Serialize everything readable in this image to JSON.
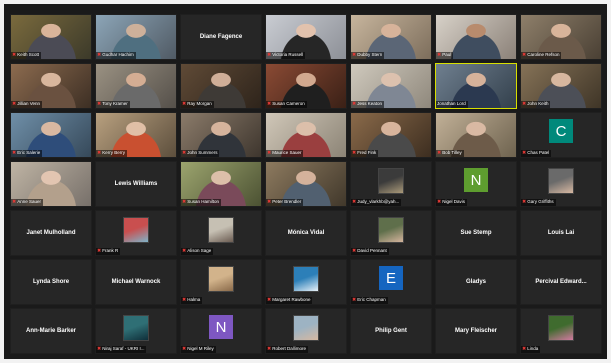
{
  "tiles": [
    {
      "name": "Keith Scott",
      "kind": "video",
      "bg": [
        "#7a6a3d",
        "#3c3a2a"
      ],
      "skin": "#d9b49a",
      "shirt": "#4b4b55",
      "muted": true
    },
    {
      "name": "Gudhar Hachim",
      "kind": "video",
      "bg": [
        "#8ca5b7",
        "#505a64"
      ],
      "skin": "#cdb09a",
      "shirt": "#4f6f80",
      "muted": true
    },
    {
      "name": "Diane Fagence",
      "kind": "name"
    },
    {
      "name": "Victoria Russell",
      "kind": "video",
      "bg": [
        "#c9ccd2",
        "#8d9097"
      ],
      "skin": "#e2c2ad",
      "shirt": "#262626",
      "muted": true
    },
    {
      "name": "Dubby Stern",
      "kind": "video",
      "bg": [
        "#c7b59d",
        "#7d6e5c"
      ],
      "skin": "#d7b39a",
      "shirt": "#5b6676",
      "muted": true
    },
    {
      "name": "Paul",
      "kind": "video",
      "bg": [
        "#d7d1c8",
        "#8b8178"
      ],
      "skin": "#b88b6d",
      "shirt": "#3f4d5f",
      "muted": true
    },
    {
      "name": "Caroline Refson",
      "kind": "video",
      "bg": [
        "#8e7f6a",
        "#4a4034"
      ],
      "skin": "#d8b49a",
      "shirt": "#6b5a4a",
      "muted": true
    },
    {
      "name": "Jillian Venn",
      "kind": "video",
      "bg": [
        "#8c6b4f",
        "#3d2f24"
      ],
      "skin": "#d8b69d",
      "shirt": "#6a5140",
      "muted": true
    },
    {
      "name": "Tony Kramer",
      "kind": "video",
      "bg": [
        "#9a9182",
        "#55504a"
      ],
      "skin": "#d4ad93",
      "shirt": "#6a6a6a",
      "muted": true
    },
    {
      "name": "Ray Morgan",
      "kind": "video",
      "bg": [
        "#5f4a36",
        "#2e241b"
      ],
      "skin": "#cfae98",
      "shirt": "#3e3a36",
      "muted": true
    },
    {
      "name": "Susan Cameron",
      "kind": "video",
      "bg": [
        "#8a4a34",
        "#3a2016"
      ],
      "skin": "#d2a98f",
      "shirt": "#1f1f1f",
      "muted": true
    },
    {
      "name": "Jess Keaton",
      "kind": "video",
      "bg": [
        "#cfc9bd",
        "#8f887c"
      ],
      "skin": "#dcc1ae",
      "shirt": "#7f8794",
      "muted": true
    },
    {
      "name": "Jonathan Lord",
      "kind": "video",
      "active": true,
      "bg": [
        "#6f7f8f",
        "#33404c"
      ],
      "skin": "#d6b29a",
      "shirt": "#2b3950",
      "muted": false
    },
    {
      "name": "John Keith",
      "kind": "video",
      "bg": [
        "#857257",
        "#3f3527"
      ],
      "skin": "#d7b79f",
      "shirt": "#4c4f57",
      "muted": true
    },
    {
      "name": "Eric Salerie",
      "kind": "video",
      "bg": [
        "#6f8fa8",
        "#36495a"
      ],
      "skin": "#d9b8a1",
      "shirt": "#2e4d7a",
      "muted": true
    },
    {
      "name": "Kerry Berry",
      "kind": "video",
      "bg": [
        "#b8a07f",
        "#5d4f3d"
      ],
      "skin": "#e0bfa6",
      "shirt": "#c95030",
      "muted": true
    },
    {
      "name": "John Summers",
      "kind": "video",
      "bg": [
        "#8b7b6a",
        "#3e362e"
      ],
      "skin": "#d5b39c",
      "shirt": "#30343a",
      "muted": true
    },
    {
      "name": "Maurice Sauer",
      "kind": "video",
      "bg": [
        "#d0c7b8",
        "#8c8476"
      ],
      "skin": "#dcbfaa",
      "shirt": "#9a3f3f",
      "muted": true
    },
    {
      "name": "Fred Fink",
      "kind": "video",
      "bg": [
        "#8a6a4a",
        "#3d2e20"
      ],
      "skin": "#d7b49c",
      "shirt": "#4a4a4a",
      "muted": true
    },
    {
      "name": "Bob Tilley",
      "kind": "video",
      "bg": [
        "#c1b097",
        "#6e634f"
      ],
      "skin": "#d9b9a3",
      "shirt": "#6d5b49",
      "muted": true
    },
    {
      "name": "Chas Patel",
      "kind": "letter",
      "letter": "C",
      "color": "#00897b",
      "muted": true
    },
    {
      "name": "Anne Sauer",
      "kind": "video",
      "bg": [
        "#bfb4a4",
        "#77706a"
      ],
      "skin": "#e2c5b1",
      "shirt": "#b3a08c",
      "muted": true
    },
    {
      "name": "Lewis Williams",
      "kind": "name"
    },
    {
      "name": "Susan Hamilton",
      "kind": "video",
      "bg": [
        "#9ca46e",
        "#4c5233"
      ],
      "skin": "#dcbfa9",
      "shirt": "#7a4a5a",
      "muted": true
    },
    {
      "name": "Peter Brendler",
      "kind": "video",
      "bg": [
        "#8d7a5f",
        "#41382b"
      ],
      "skin": "#d4b29b",
      "shirt": "#516070",
      "muted": true
    },
    {
      "name": "Judy_vlarkhb@yah...",
      "kind": "photo",
      "photo": [
        "#3b3b3b",
        "#aa9a7a"
      ],
      "muted": true
    },
    {
      "name": "Nigel Davis",
      "kind": "letter",
      "letter": "N",
      "color": "#5e9d2f",
      "muted": true
    },
    {
      "name": "Gary Griffiths",
      "kind": "photo",
      "photo": [
        "#6a6a6a",
        "#d7b8a2"
      ],
      "muted": true
    },
    {
      "name": "Janet Mulholland",
      "kind": "name"
    },
    {
      "name": "Frank R",
      "kind": "photo",
      "photo": [
        "#c94f4f",
        "#7fb3c8"
      ],
      "muted": true
    },
    {
      "name": "Alison Sage",
      "kind": "photo",
      "photo": [
        "#c6c0b3",
        "#6b5c52"
      ],
      "muted": true
    },
    {
      "name": "Mónica Vidal",
      "kind": "name"
    },
    {
      "name": "David Pennant",
      "kind": "photo",
      "photo": [
        "#5f6f4b",
        "#d4b49d"
      ],
      "muted": true
    },
    {
      "name": "Sue Stemp",
      "kind": "name"
    },
    {
      "name": "Louis Lai",
      "kind": "name"
    },
    {
      "name": "Lynda Shore",
      "kind": "name"
    },
    {
      "name": "Michael Warnock",
      "kind": "name"
    },
    {
      "name": "Halma",
      "kind": "photo",
      "photo": [
        "#d2b38b",
        "#8a6a4a"
      ],
      "muted": true
    },
    {
      "name": "Margaret Rawbone",
      "kind": "photo",
      "photo": [
        "#2c7fb8",
        "#e8f1f8"
      ],
      "muted": true
    },
    {
      "name": "Eric Chapman",
      "kind": "letter",
      "letter": "E",
      "color": "#1565c0",
      "muted": true
    },
    {
      "name": "Gladys",
      "kind": "name"
    },
    {
      "name": "Percival Edward...",
      "kind": "name"
    },
    {
      "name": "Ann-Marie Barker",
      "kind": "name"
    },
    {
      "name": "Niraj Saraf - UKRI I...",
      "kind": "photo",
      "photo": [
        "#2f6f75",
        "#0f2f3a"
      ],
      "muted": true
    },
    {
      "name": "Nigel M Riley",
      "kind": "letter",
      "letter": "N",
      "color": "#7e57c2",
      "muted": true
    },
    {
      "name": "Robert Dallimore",
      "kind": "photo",
      "photo": [
        "#9db3c3",
        "#d6b8a1"
      ],
      "muted": true
    },
    {
      "name": "Philip Gent",
      "kind": "name"
    },
    {
      "name": "Mary Fleischer",
      "kind": "name"
    },
    {
      "name": "Linda",
      "kind": "photo",
      "photo": [
        "#3f6b2e",
        "#d27aa0"
      ],
      "muted": true
    }
  ]
}
